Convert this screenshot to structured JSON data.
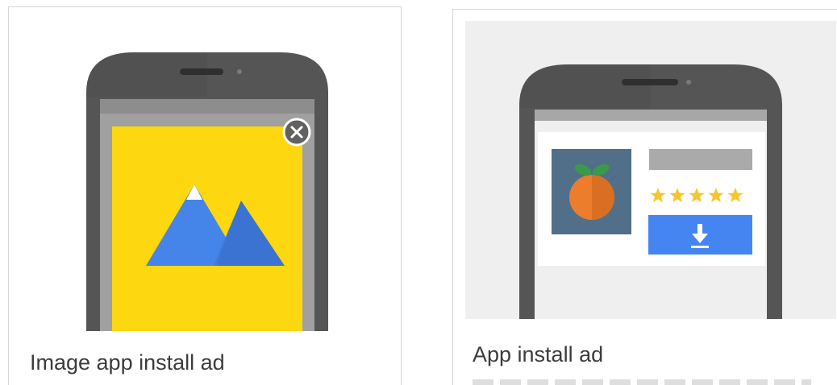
{
  "cards": [
    {
      "caption": "Image app install ad",
      "icons": [
        "phone-icon",
        "mountain-image-icon",
        "close-icon"
      ],
      "colors": {
        "ad_background": "#fdd70f",
        "mountain": "#4584e8",
        "close_button": "#616161"
      }
    },
    {
      "caption": "App install ad",
      "icons": [
        "phone-icon",
        "orange-fruit-icon",
        "star-icon",
        "download-icon"
      ],
      "rating_stars": 5,
      "colors": {
        "app_icon_bg": "#516f88",
        "fruit": "#ec7d2c",
        "stars": "#f7c52e",
        "install_button": "#4585f2"
      }
    }
  ]
}
